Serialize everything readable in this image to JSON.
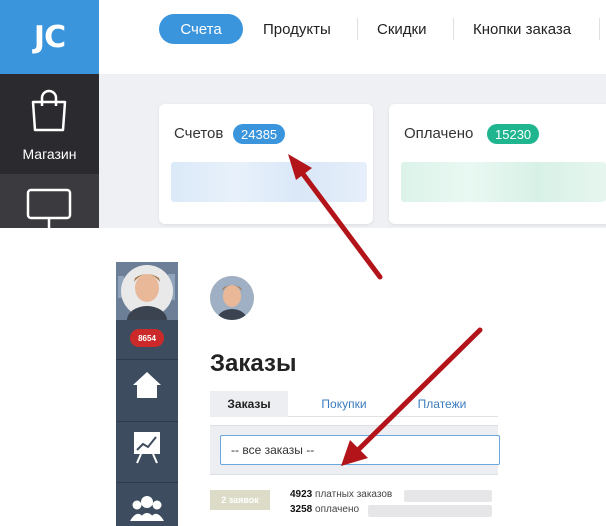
{
  "top_app": {
    "logo_text": "JC",
    "nav": {
      "active": "Счета",
      "items": [
        "Продукты",
        "Скидки",
        "Кнопки заказа"
      ]
    },
    "sidebar": {
      "shop_label": "Магазин",
      "shop_icon": "shopping-bag-icon",
      "second_icon": "monitor-icon"
    },
    "cards": [
      {
        "label": "Счетов",
        "badge": "24385",
        "badge_color": "#3a95dc"
      },
      {
        "label": "Оплачено",
        "badge": "15230",
        "badge_color": "#1fb58f"
      }
    ]
  },
  "bottom_app": {
    "notification_count": "8654",
    "sidebar_icons": [
      "home-icon",
      "chart-board-icon",
      "users-icon"
    ],
    "page_title": "Заказы",
    "tabs": [
      "Заказы",
      "Покупки",
      "Платежи"
    ],
    "filter_value": "-- все заказы --",
    "requests_badge": "2 заявок",
    "stats": [
      {
        "number": "4923",
        "text": "платных заказов"
      },
      {
        "number": "3258",
        "text": "оплачено"
      }
    ]
  },
  "colors": {
    "accent_blue": "#3a95dc",
    "accent_green": "#1fb58f",
    "arrow_red": "#b3141a",
    "sidebar_dark": "#2f2f33",
    "sidebar_slate": "#3d4c5e"
  }
}
